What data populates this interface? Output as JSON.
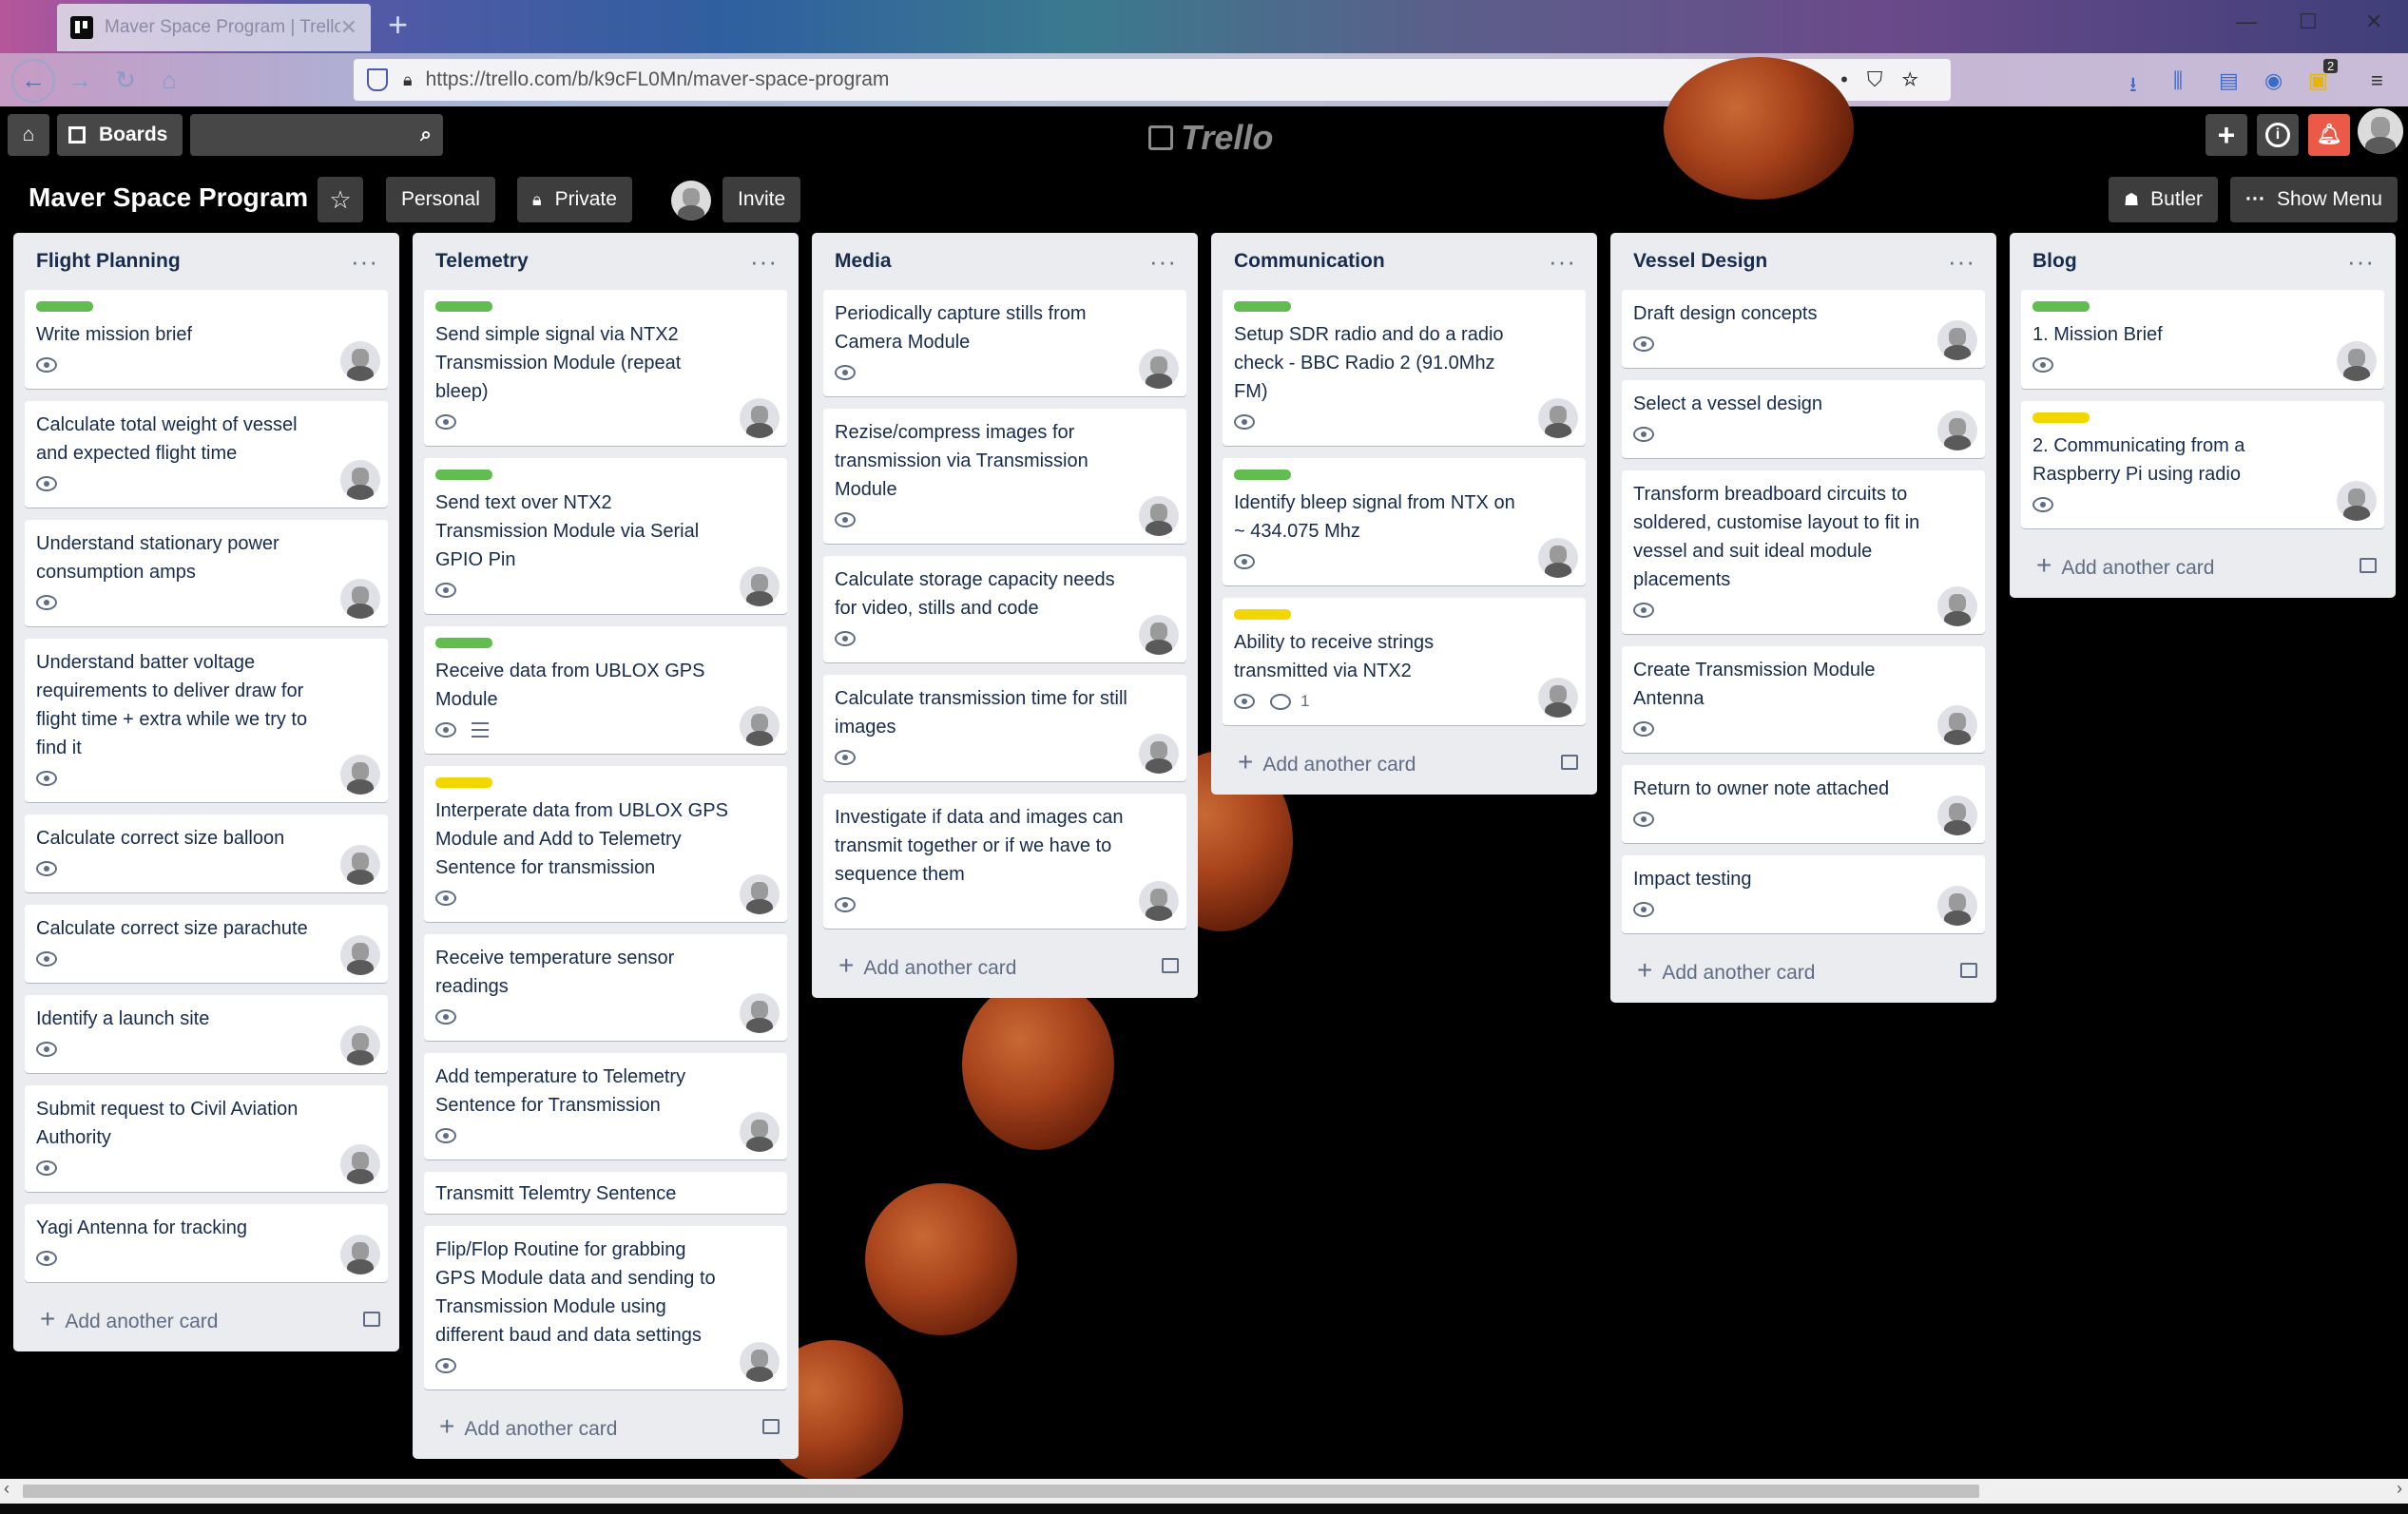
{
  "browser": {
    "tab_title": "Maver Space Program | Trello",
    "url": "https://trello.com/b/k9cFL0Mn/maver-space-program",
    "downloads_badge": "2"
  },
  "header": {
    "boards_label": "Boards",
    "logo": "Trello"
  },
  "board": {
    "title": "Maver Space Program",
    "team": "Personal",
    "visibility": "Private",
    "invite_label": "Invite",
    "butler_label": "Butler",
    "show_menu_label": "Show Menu"
  },
  "colors": {
    "green": "#61bd4f",
    "yellow": "#f2d600"
  },
  "add_card_label": "Add another card",
  "lists": [
    {
      "title": "Flight Planning",
      "cards": [
        {
          "title": "Write mission brief",
          "label": "green"
        },
        {
          "title": "Calculate total weight of vessel and expected flight time"
        },
        {
          "title": "Understand stationary power consumption amps"
        },
        {
          "title": "Understand batter voltage requirements to deliver draw for flight time + extra while we try to find it"
        },
        {
          "title": "Calculate correct size balloon"
        },
        {
          "title": "Calculate correct size parachute"
        },
        {
          "title": "Identify a launch site"
        },
        {
          "title": "Submit request to Civil Aviation Authority"
        },
        {
          "title": "Yagi Antenna for tracking"
        }
      ]
    },
    {
      "title": "Telemetry",
      "cards": [
        {
          "title": "Send simple signal via NTX2 Transmission Module (repeat bleep)",
          "label": "green"
        },
        {
          "title": "Send text over NTX2 Transmission Module via Serial GPIO Pin",
          "label": "green"
        },
        {
          "title": "Receive data from UBLOX GPS Module",
          "label": "green",
          "description": true
        },
        {
          "title": "Interperate data from UBLOX GPS Module and Add to Telemetry Sentence for transmission",
          "label": "yellow"
        },
        {
          "title": "Receive temperature sensor readings"
        },
        {
          "title": "Add temperature to Telemetry Sentence for Transmission"
        },
        {
          "title": "Transmitt Telemtry Sentence",
          "plain": true
        },
        {
          "title": "Flip/Flop Routine for grabbing GPS Module data and sending to Transmission Module using different baud and data settings"
        }
      ]
    },
    {
      "title": "Media",
      "cards": [
        {
          "title": "Periodically capture stills from Camera Module"
        },
        {
          "title": "Rezise/compress images for transmission via Transmission Module"
        },
        {
          "title": "Calculate storage capacity needs for video, stills and code"
        },
        {
          "title": "Calculate transmission time for still images"
        },
        {
          "title": "Investigate if data and images can transmit together or if we have to sequence them"
        }
      ]
    },
    {
      "title": "Communication",
      "cards": [
        {
          "title": "Setup SDR radio and do a radio check - BBC Radio 2 (91.0Mhz FM)",
          "label": "green"
        },
        {
          "title": "Identify bleep signal from NTX on ~ 434.075 Mhz",
          "label": "green"
        },
        {
          "title": "Ability to receive strings transmitted via NTX2",
          "label": "yellow",
          "comments": "1"
        }
      ]
    },
    {
      "title": "Vessel Design",
      "cards": [
        {
          "title": "Draft design concepts"
        },
        {
          "title": "Select a vessel design"
        },
        {
          "title": "Transform breadboard circuits to soldered, customise layout to fit in vessel and suit ideal module placements"
        },
        {
          "title": "Create Transmission Module Antenna"
        },
        {
          "title": "Return to owner note attached"
        },
        {
          "title": "Impact testing"
        }
      ]
    },
    {
      "title": "Blog",
      "cards": [
        {
          "title": "1. Mission Brief",
          "label": "green"
        },
        {
          "title": "2. Communicating from a Raspberry Pi using radio",
          "label": "yellow"
        }
      ]
    }
  ]
}
